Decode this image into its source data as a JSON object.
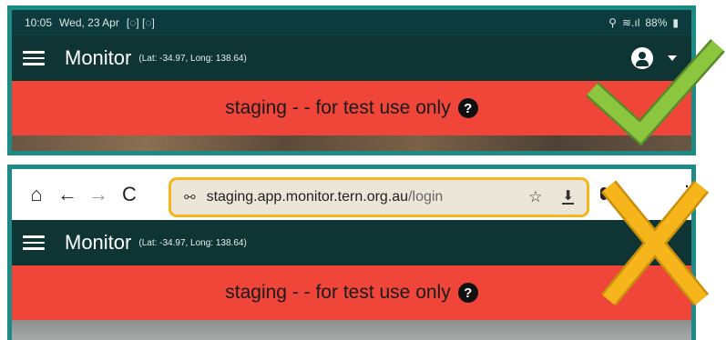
{
  "status_bar": {
    "time": "10:05",
    "date": "Wed, 23 Apr",
    "icons_left": "[◌] [◌]",
    "battery": "88%"
  },
  "app_bar": {
    "title": "Monitor",
    "coordinates": "(Lat: -34.97, Long: 138.64)"
  },
  "banner": {
    "text": "staging - - for test use only",
    "help_symbol": "?"
  },
  "browser": {
    "url_host": "staging.app.monitor.tern.org.au",
    "url_path": "/login",
    "home_symbol": "⌂",
    "back_symbol": "←",
    "forward_symbol": "→",
    "reload_symbol": "C",
    "star_symbol": "☆",
    "download_symbol": "⬇",
    "menu_symbol": "⋮"
  },
  "colors": {
    "panel_border": "#1e8a86",
    "app_bar": "#0f3434",
    "banner": "#f0463a",
    "url_highlight": "#f6b51b",
    "check_mark": "#8cc63f",
    "cross_mark": "#f6b51b"
  }
}
